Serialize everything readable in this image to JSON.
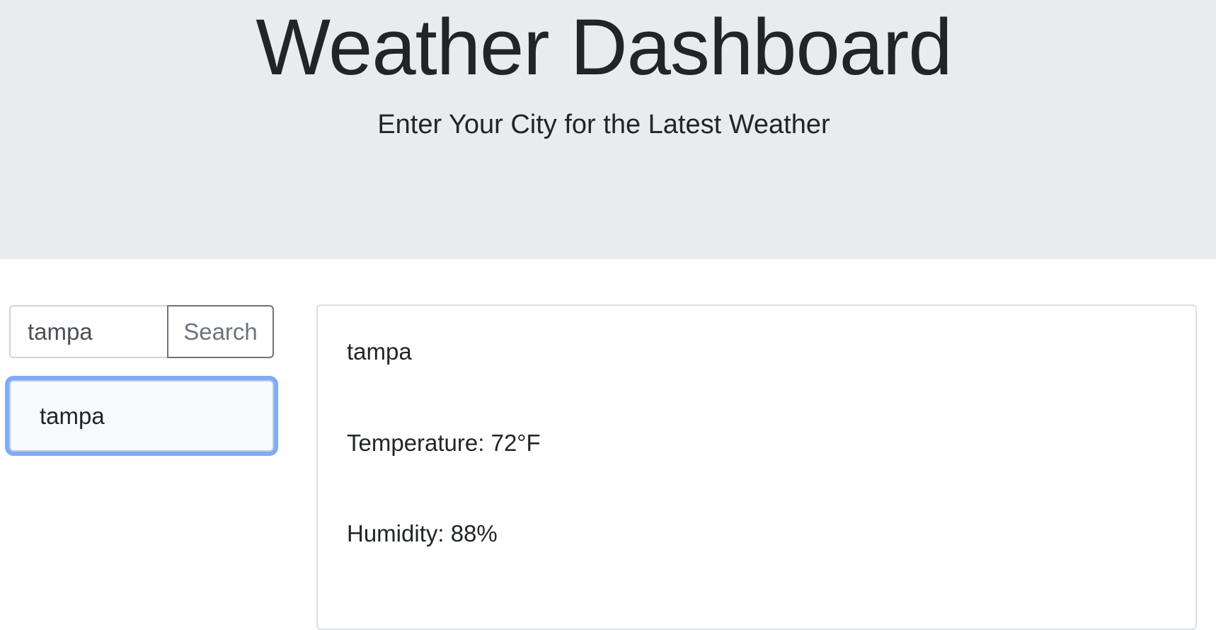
{
  "header": {
    "title": "Weather Dashboard",
    "subtitle": "Enter Your City for the Latest Weather"
  },
  "search": {
    "input_value": "tampa",
    "button_label": "Search"
  },
  "history": {
    "items": [
      "tampa"
    ]
  },
  "weather": {
    "city": "tampa",
    "temperature": "Temperature: 72°F",
    "humidity": "Humidity: 88%"
  }
}
